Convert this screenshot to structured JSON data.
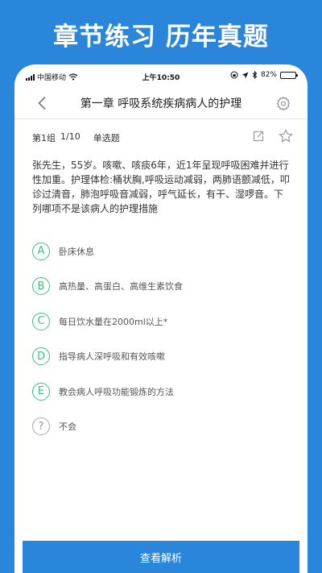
{
  "promo_title": "章节练习  历年真题",
  "status_bar": {
    "carrier": "中国移动",
    "time": "上午10:50",
    "battery_text": "82%",
    "battery_level": 0.82
  },
  "nav": {
    "title": "第一章  呼吸系统疾病病人的护理"
  },
  "question_bar": {
    "group": "第1组",
    "progress": "1/10",
    "type": "单选题"
  },
  "question": {
    "text": "张先生，55岁。咳嗽、咳痰6年，近1年呈现呼吸困难并进行性加重。护理体检:桶状胸,呼吸运动减弱，两肺语颤减低，叩诊过清音，肺泡呼吸音减弱，呼气延长，有干、湿啰音。下列哪项不是该病人的护理措施"
  },
  "options": [
    {
      "letter": "A",
      "text": "卧床休息"
    },
    {
      "letter": "B",
      "text": "高热量、高蛋白、高维生素饮食"
    },
    {
      "letter": "C",
      "text": "每日饮水量在2000ml以上*"
    },
    {
      "letter": "D",
      "text": "指导病人深呼吸和有效咳嗽"
    },
    {
      "letter": "E",
      "text": "教会病人呼吸功能锻炼的方法"
    },
    {
      "letter": "?",
      "text": "不会"
    }
  ],
  "bottom_button": "查看解析",
  "colors": {
    "brand_blue": "#2a86db",
    "option_green": "#3cbf84"
  },
  "icons": {
    "back": "chevron-left-icon",
    "settings": "gear-icon",
    "share": "share-icon",
    "favorite": "star-icon"
  }
}
